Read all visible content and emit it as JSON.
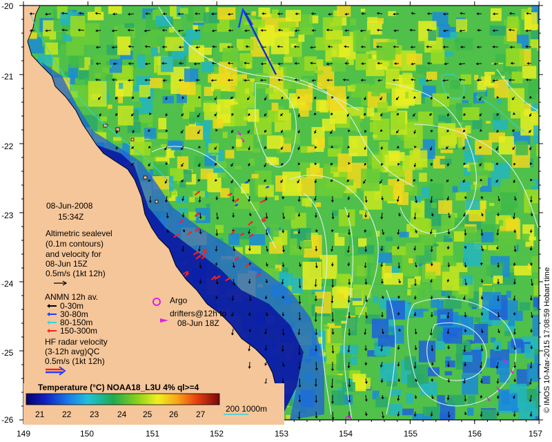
{
  "map": {
    "date": "08-Jun-2008",
    "time": "15:34Z",
    "lon_ticks": [
      "149",
      "150",
      "151",
      "152",
      "153",
      "154",
      "155",
      "156",
      "157"
    ],
    "lat_ticks": [
      "-20",
      "-21",
      "-22",
      "-23",
      "-24",
      "-25",
      "-26"
    ],
    "credit": "© IMOS 10-Mar-2015 17:08:59 Hobart time"
  },
  "legend": {
    "altimetric": [
      "Altimetric sealevel",
      "(0.1m contours)",
      "and velocity for",
      "08-Jun 15Z",
      "0.5m/s (1kt 12h)"
    ],
    "anmn_title": "ANMN 12h av.",
    "anmn_items": [
      {
        "label": "0-30m",
        "color": "#000000"
      },
      {
        "label": "30-80m",
        "color": "#1f3fff"
      },
      {
        "label": "80-150m",
        "color": "#35d2e8"
      },
      {
        "label": "150-300m",
        "color": "#ff2020"
      }
    ],
    "hf_radar": [
      "HF radar velocity",
      "(3-12h avg)QC",
      "0.5m/s (1kt 12h)"
    ],
    "argo_label": "Argo",
    "drifters": [
      "drifters@12h to",
      "08-Jun 18Z"
    ],
    "bathy_label": "200  1000m"
  },
  "colorbar": {
    "title": "Temperature (°C) NOAA18_L3U 4% ql>=4",
    "ticks": [
      "21",
      "22",
      "23",
      "24",
      "25",
      "26",
      "27"
    ]
  },
  "colors": {
    "land": "#f5c69a",
    "argo": "#e020e0",
    "drifter_arrow": "#e020e0",
    "hf_red": "#ff2020",
    "hf_blue": "#1f3fff"
  }
}
